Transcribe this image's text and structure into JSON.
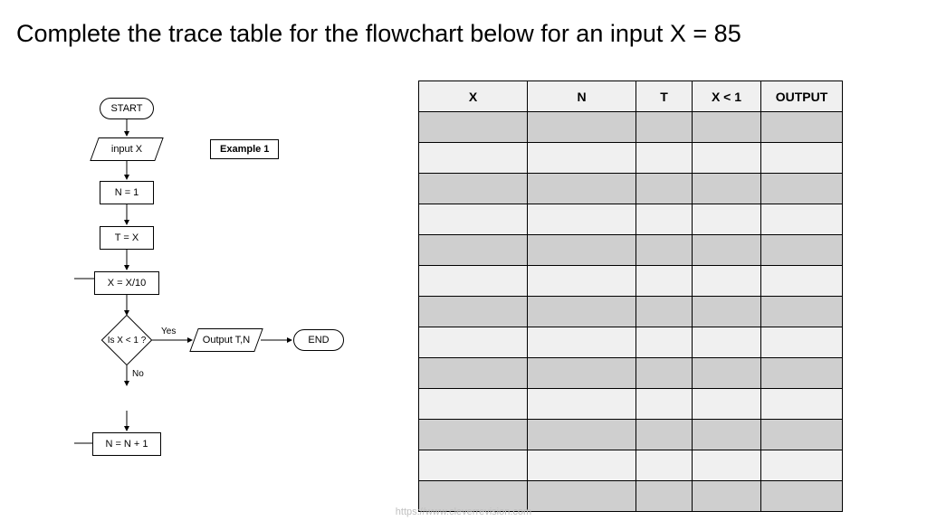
{
  "title": "Complete the trace table for the flowchart below for an input X = 85",
  "example_label": "Example 1",
  "flowchart": {
    "start": "START",
    "input": "input X",
    "n1": "N = 1",
    "tx": "T = X",
    "xdiv": "X = X/10",
    "decision": "Is X < 1 ?",
    "yes": "Yes",
    "no": "No",
    "output": "Output T,N",
    "end": "END",
    "ninc": "N = N + 1"
  },
  "table": {
    "headers": [
      "X",
      "N",
      "T",
      "X < 1",
      "OUTPUT"
    ],
    "rows": 13
  },
  "footer": "https://www.cleverrevision.com"
}
